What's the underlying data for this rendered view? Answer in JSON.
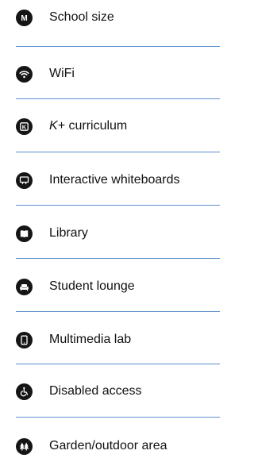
{
  "features": [
    {
      "icon": "school-size-m-icon",
      "label": "School size"
    },
    {
      "icon": "wifi-icon",
      "label": "WiFi"
    },
    {
      "icon": "k-curriculum-icon",
      "label_italic": "K+",
      "label": " curriculum"
    },
    {
      "icon": "interactive-whiteboard-icon",
      "label": "Interactive whiteboards"
    },
    {
      "icon": "library-book-icon",
      "label": "Library"
    },
    {
      "icon": "student-lounge-sofa-icon",
      "label": "Student lounge"
    },
    {
      "icon": "multimedia-tablet-icon",
      "label": "Multimedia lab"
    },
    {
      "icon": "disabled-access-icon",
      "label": "Disabled access"
    },
    {
      "icon": "garden-tree-icon",
      "label": "Garden/outdoor area"
    }
  ],
  "colors": {
    "icon_bg": "#151515",
    "divider": "#5b8fcb",
    "text": "#111111"
  }
}
